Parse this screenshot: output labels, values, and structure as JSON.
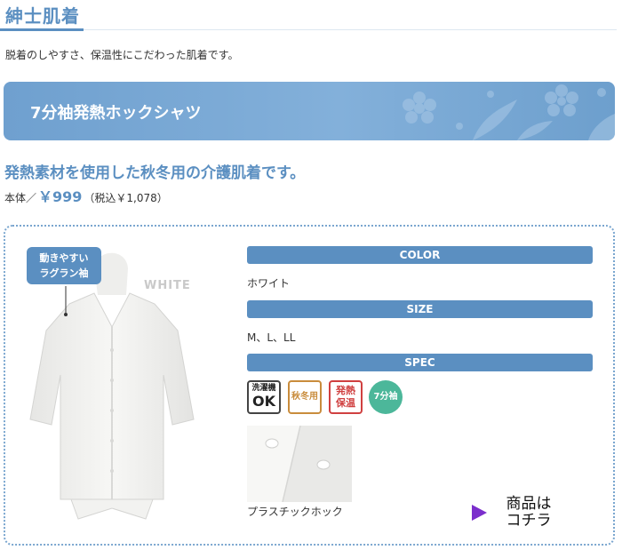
{
  "section": {
    "title": "紳士肌着"
  },
  "intro": "脱着のしやすさ、保温性にこだわった肌着です。",
  "banner": {
    "title": "7分袖発熱ホックシャツ"
  },
  "product": {
    "catchphrase": "発熱素材を使用した秋冬用の介護肌着です。",
    "price_label": "本体／",
    "price": "￥999",
    "price_tax": "（税込￥1,078）",
    "photo_callout_line1": "動きやすい",
    "photo_callout_line2": "ラグラン袖",
    "photo_tag": "WHITE",
    "color_header": "COLOR",
    "color_value": "ホワイト",
    "size_header": "SIZE",
    "size_value": "M、L、LL",
    "spec_header": "SPEC",
    "spec_badges": [
      {
        "line1": "洗濯機",
        "line2": "OK"
      },
      {
        "line1": "秋冬用"
      },
      {
        "line1": "発熱",
        "line2": "保温"
      },
      {
        "line1": "7分袖"
      }
    ],
    "detail_caption": "プラスチックホック",
    "link_line1": "商品は",
    "link_line2": "コチラ"
  },
  "colors": {
    "accent": "#5b8fc1",
    "box_border": "#7aa6cf",
    "link_arrow": "#7b2ecc",
    "badge_green": "#4cb79a"
  }
}
